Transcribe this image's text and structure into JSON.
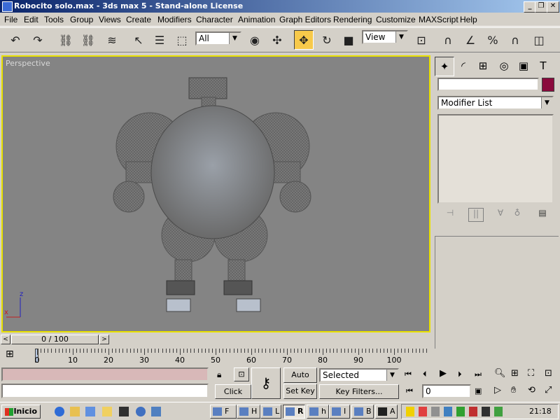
{
  "window": {
    "title": "Robocito solo.max - 3ds max 5 - Stand-alone License",
    "controls": [
      "_",
      "❐",
      "✕"
    ]
  },
  "menu": [
    "File",
    "Edit",
    "Tools",
    "Group",
    "Views",
    "Create",
    "Modifiers",
    "Character",
    "Animation",
    "Graph Editors",
    "Rendering",
    "Customize",
    "MAXScript",
    "Help"
  ],
  "toolbar": {
    "selection_filter": "All",
    "reference_coord": "View"
  },
  "viewport": {
    "label": "Perspective",
    "axis_z": "z",
    "axis_x": "x",
    "border_color": "#e8e000"
  },
  "command_panel": {
    "modifier_list": "Modifier List",
    "object_color": "#8a0a3c"
  },
  "time_slider": {
    "frame": "0 / 100",
    "prev": "<",
    "next": ">"
  },
  "track_bar": {
    "ticks": [
      "0",
      "10",
      "20",
      "30",
      "40",
      "50",
      "60",
      "70",
      "80",
      "90",
      "100"
    ]
  },
  "status": {
    "click_and": "Click and",
    "auto_key": "Auto Key",
    "set_key": "Set Key",
    "selected": "Selected",
    "key_filters": "Key Filters...",
    "frame_value": "0"
  },
  "taskbar": {
    "start": "Inicio",
    "clock": "21:18",
    "tasks": [
      {
        "label": "F"
      },
      {
        "label": "H"
      },
      {
        "label": "L"
      },
      {
        "label": "R"
      },
      {
        "label": "h"
      },
      {
        "label": "I"
      },
      {
        "label": "B"
      },
      {
        "label": "A"
      }
    ]
  }
}
